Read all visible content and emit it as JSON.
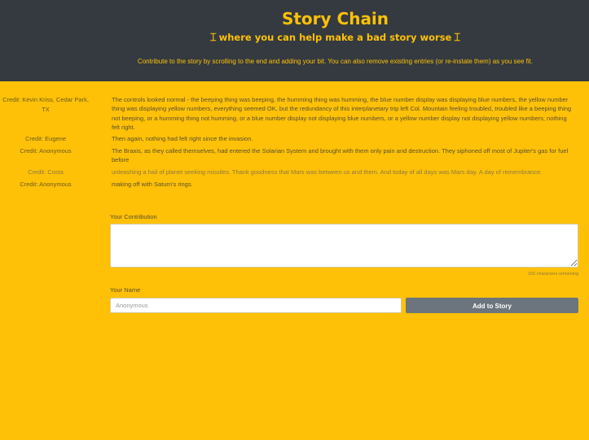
{
  "header": {
    "title": "Story Chain",
    "cursor_icon": "text-cursor-icon",
    "subtitle": "where you can help make a bad story worse",
    "instructions": "Contribute to the story by scrolling to the end and adding your bit. You can also remove existing entries (or re-instate them) as you see fit."
  },
  "entries": [
    {
      "credit": "Credit: Kevin Kriss, Cedar Park, TX",
      "text": "The controls looked normal - the beeping thing was beeping, the humming thing was humming, the blue number display was displaying blue numbers, the yellow number thing was displaying yellow numbers, everything seemed OK, but the redundancy of this interplanetary trip left Col. Mountain feeling troubled, troubled like a beeping thing not beeping, or a humming thing not humming, or a blue number display not displaying blue numbers, or a yellow number display not displaying yellow numbers; nothing felt right.",
      "removed": false
    },
    {
      "credit": "Credit: Eugene",
      "text": "Then again, nothing had felt right since the invasion.",
      "removed": false
    },
    {
      "credit": "Credit: Anonymous",
      "text": "The Braxis, as they called themselves, had entered the Solarian System and brought with them only pain and destruction. They siphoned off most of Jupiter's gas for fuel before",
      "removed": false
    },
    {
      "credit": "Credit: Costa",
      "text": "unleashing a hail of planet seeking missiles. Thank goodness that Mars was between us and them. And today of all days was Mars day. A day of remembrance.",
      "removed": true
    },
    {
      "credit": "Credit: Anonymous",
      "text": "making off with Saturn's rings.",
      "removed": false
    }
  ],
  "form": {
    "contribution_label": "Your Contribution",
    "contribution_value": "",
    "chars_remaining": "150 characters remaining",
    "name_label": "Your Name",
    "name_placeholder": "Anonymous",
    "name_value": "",
    "submit_label": "Add to Story"
  },
  "colors": {
    "header_bg": "#343a40",
    "accent": "#ffc107",
    "button_bg": "#6c757d"
  }
}
